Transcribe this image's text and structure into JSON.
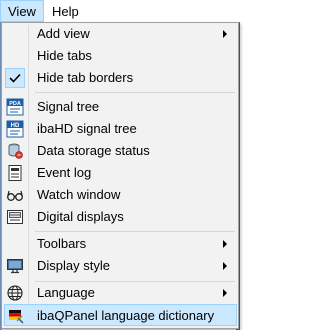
{
  "menubar": {
    "view": "View",
    "help": "Help"
  },
  "menu": {
    "add_view": "Add view",
    "hide_tabs": "Hide tabs",
    "hide_tab_borders": "Hide tab borders",
    "signal_tree": "Signal tree",
    "signal_tree_icon_text": "PDA",
    "ibahd_signal_tree": "ibaHD signal tree",
    "ibahd_icon_text": "HD",
    "data_storage_status": "Data storage status",
    "event_log": "Event log",
    "watch_window": "Watch window",
    "digital_displays": "Digital displays",
    "toolbars": "Toolbars",
    "display_style": "Display style",
    "language": "Language",
    "dictionary": "ibaQPanel language dictionary"
  },
  "state": {
    "hide_tab_borders_checked": true,
    "highlighted_item": "ibaQPanel language dictionary"
  },
  "colors": {
    "highlight_bg": "#cce8ff",
    "highlight_border": "#99d1ff",
    "menu_bg": "#f2f2f2",
    "icon_blue": "#1f5fa8"
  }
}
